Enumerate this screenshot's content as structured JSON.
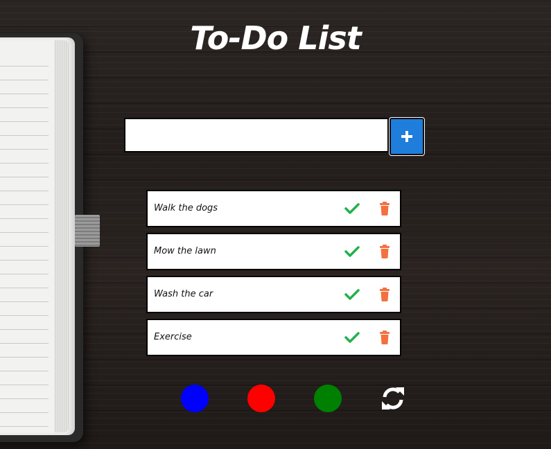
{
  "app": {
    "title": "To-Do List"
  },
  "add_form": {
    "input_value": "",
    "input_placeholder": "",
    "add_icon": "plus-icon"
  },
  "todos": [
    {
      "text": "Walk the dogs"
    },
    {
      "text": "Mow the lawn"
    },
    {
      "text": "Wash the car"
    },
    {
      "text": "Exercise"
    }
  ],
  "item_icons": {
    "complete": "check-icon",
    "delete": "trash-icon"
  },
  "theme_options": [
    {
      "name": "blue",
      "color": "#0000ff"
    },
    {
      "name": "red",
      "color": "#ff0000"
    },
    {
      "name": "green",
      "color": "#008000"
    }
  ],
  "refresh_icon": "refresh-icon",
  "colors": {
    "add_button": "#1f7ddc",
    "check": "#22b14c",
    "trash": "#f27140",
    "title": "#ffffff"
  }
}
